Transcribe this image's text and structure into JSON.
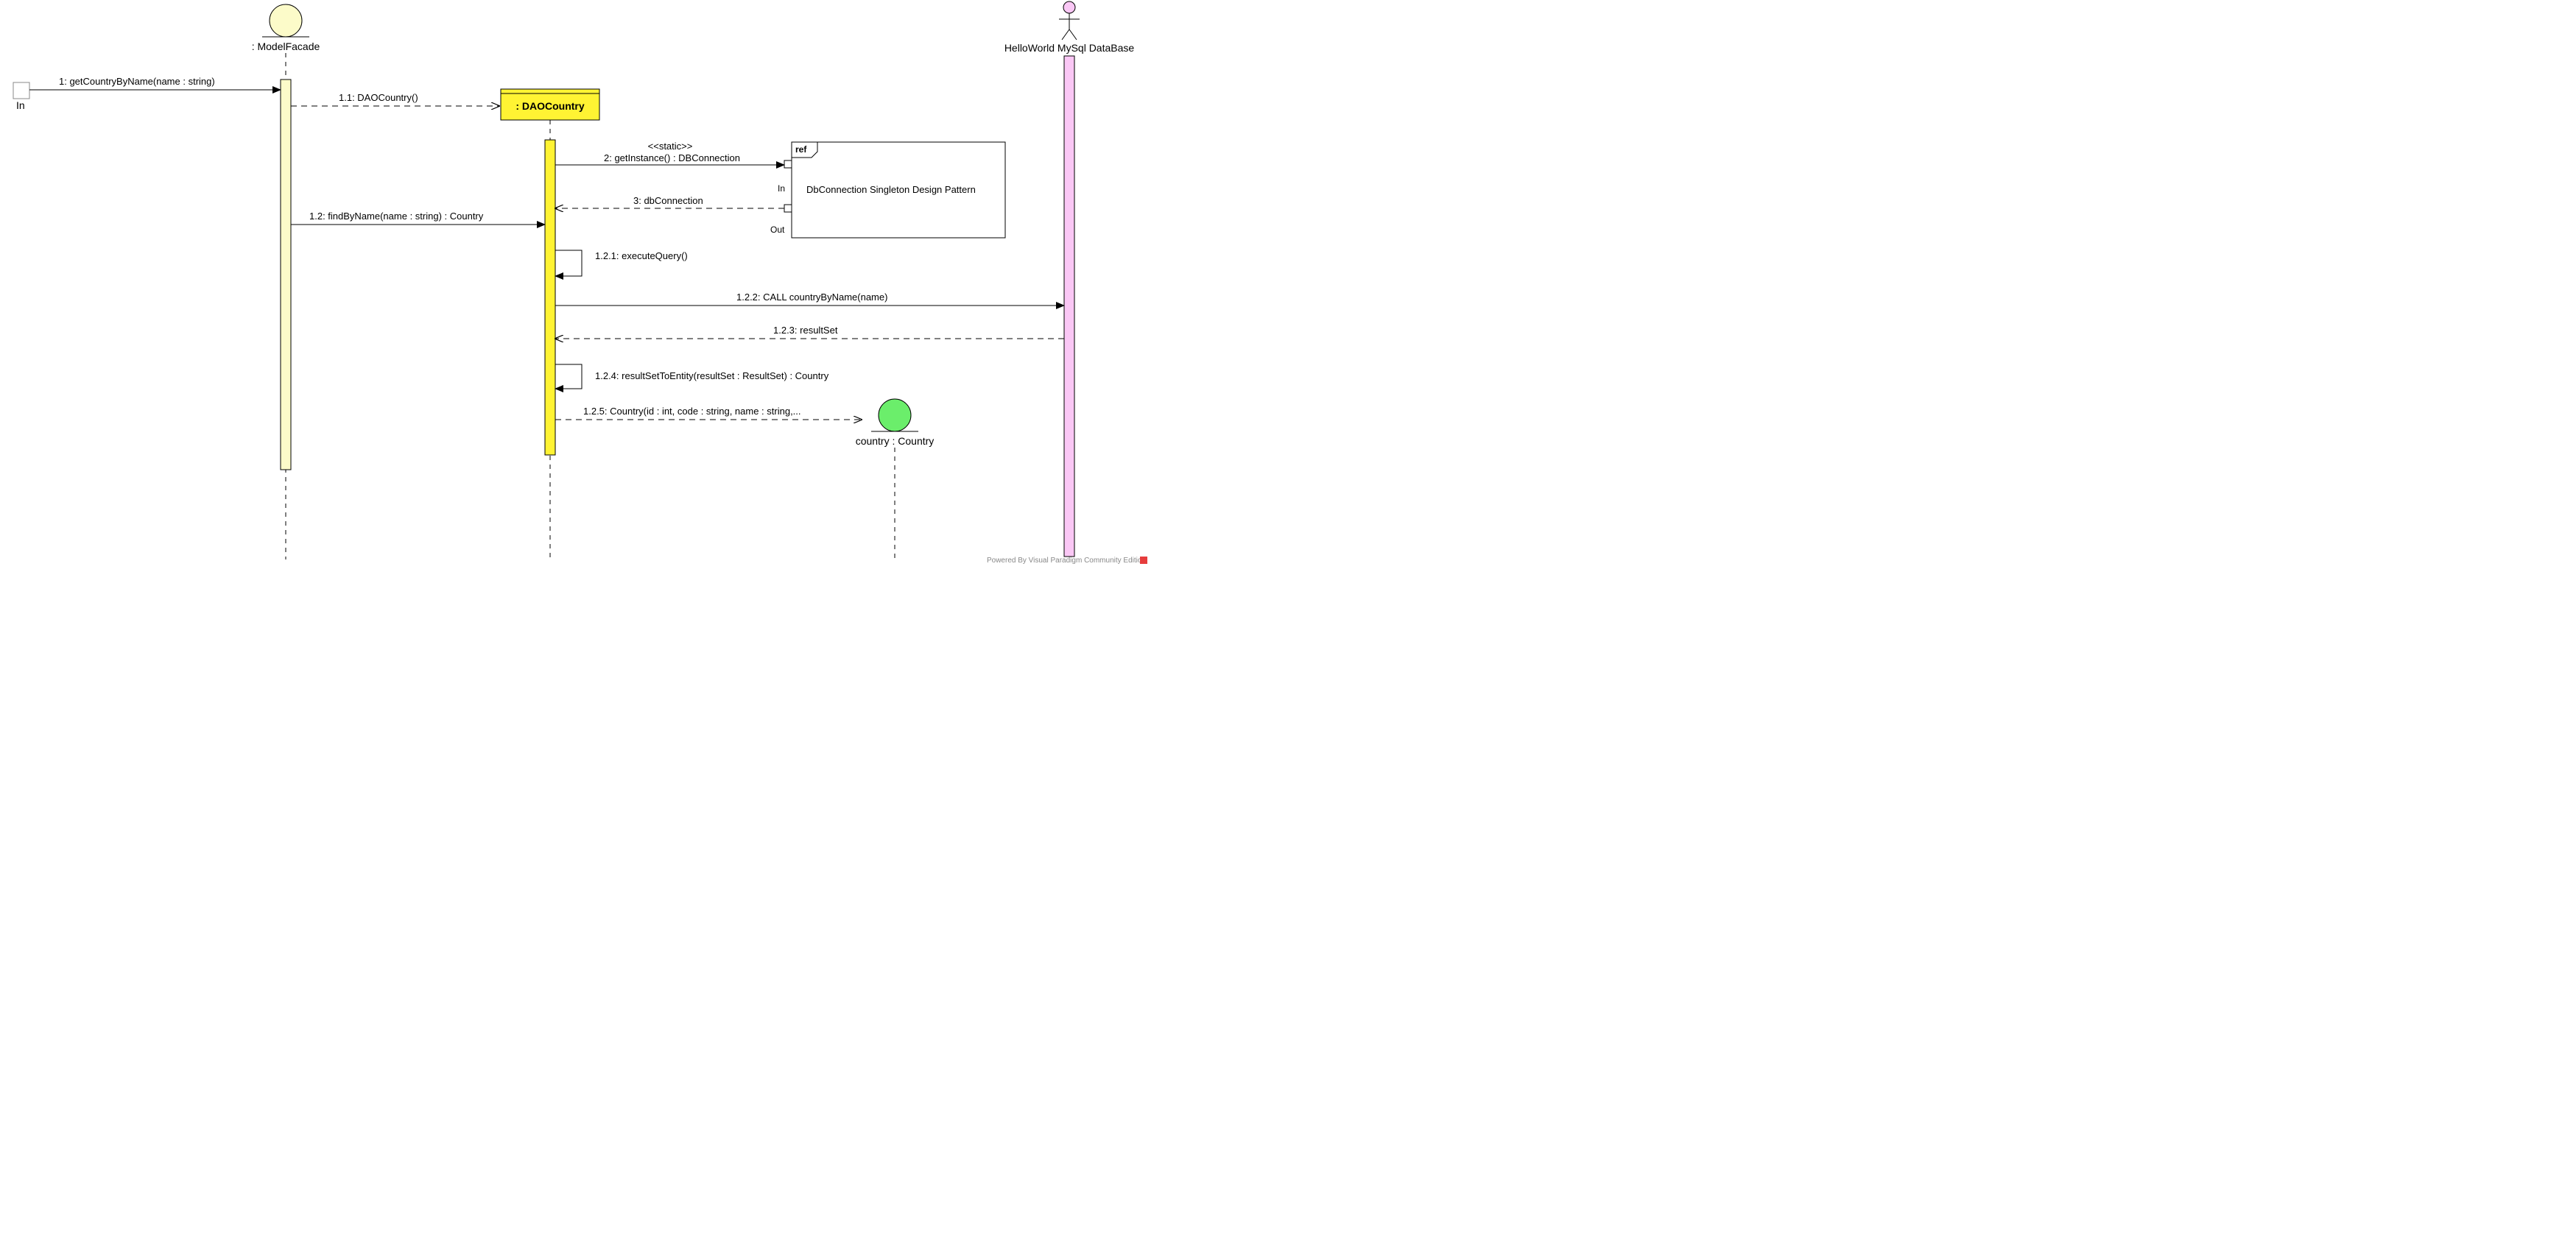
{
  "participants": {
    "in_gate": "In",
    "model_facade": ": ModelFacade",
    "dao_country": ": DAOCountry",
    "database": "HelloWorld MySql DataBase",
    "country": "country : Country"
  },
  "messages": {
    "m1": "1: getCountryByName(name : string)",
    "m1_1": "1.1: DAOCountry()",
    "m2_stereo": "<<static>>",
    "m2": "2: getInstance() : DBConnection",
    "m3": "3: dbConnection",
    "m1_2": "1.2: findByName(name : string) : Country",
    "m1_2_1": "1.2.1: executeQuery()",
    "m1_2_2": "1.2.2: CALL countryByName(name)",
    "m1_2_3": "1.2.3: resultSet",
    "m1_2_4": "1.2.4: resultSetToEntity(resultSet : ResultSet) : Country",
    "m1_2_5": "1.2.5: Country(id : int, code : string, name : string,..."
  },
  "ref_frame": {
    "tag": "ref",
    "name": "DbConnection Singleton Design Pattern",
    "in": "In",
    "out": "Out"
  },
  "watermark": "Powered By Visual Paradigm Community Edition"
}
